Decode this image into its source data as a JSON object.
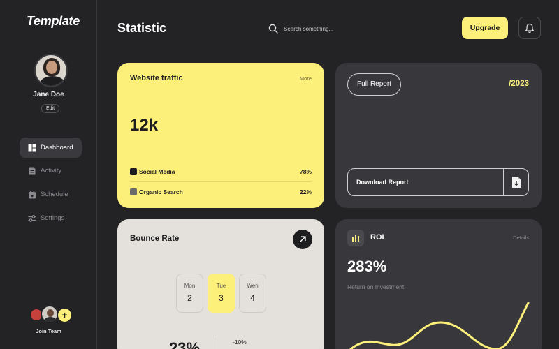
{
  "app": {
    "logo": "Template"
  },
  "profile": {
    "name": "Jane Doe",
    "edit_label": "Edit"
  },
  "nav": [
    {
      "label": "Dashboard",
      "icon": "dashboard-icon",
      "active": true
    },
    {
      "label": "Activity",
      "icon": "document-icon",
      "active": false
    },
    {
      "label": "Schedule",
      "icon": "calendar-icon",
      "active": false
    },
    {
      "label": "Settings",
      "icon": "sliders-icon",
      "active": false
    }
  ],
  "team": {
    "label": "Join Team",
    "add_icon": "+"
  },
  "header": {
    "title": "Statistic",
    "search_placeholder": "Search something...",
    "upgrade_label": "Upgrade",
    "bell_icon": "bell-icon"
  },
  "traffic": {
    "title": "Website traffic",
    "more_label": "More",
    "value": "12k",
    "rows": [
      {
        "label": "Social Media",
        "percent": "78%",
        "color": "#1d1d1f"
      },
      {
        "label": "Organic Search",
        "percent": "22%",
        "color": "#6b6b6b"
      }
    ]
  },
  "report": {
    "full_report_label": "Full Report",
    "year": "/2023",
    "download_label": "Download Report",
    "download_icon": "file-download-icon"
  },
  "bounce": {
    "title": "Bounce Rate",
    "arrow_icon": "arrow-up-right-icon",
    "days": [
      {
        "name": "Mon",
        "date": "2",
        "active": false
      },
      {
        "name": "Tue",
        "date": "3",
        "active": true
      },
      {
        "name": "Wen",
        "date": "4",
        "active": false
      }
    ],
    "value": "23%",
    "delta": "-10%"
  },
  "roi": {
    "title": "ROI",
    "icon": "bar-chart-icon",
    "details_label": "Details",
    "value": "283%",
    "subtitle": "Return on Investment"
  },
  "colors": {
    "accent": "#fdf07a",
    "background": "#232326",
    "card_dark": "#38383c",
    "card_light": "#e4e1dc"
  }
}
